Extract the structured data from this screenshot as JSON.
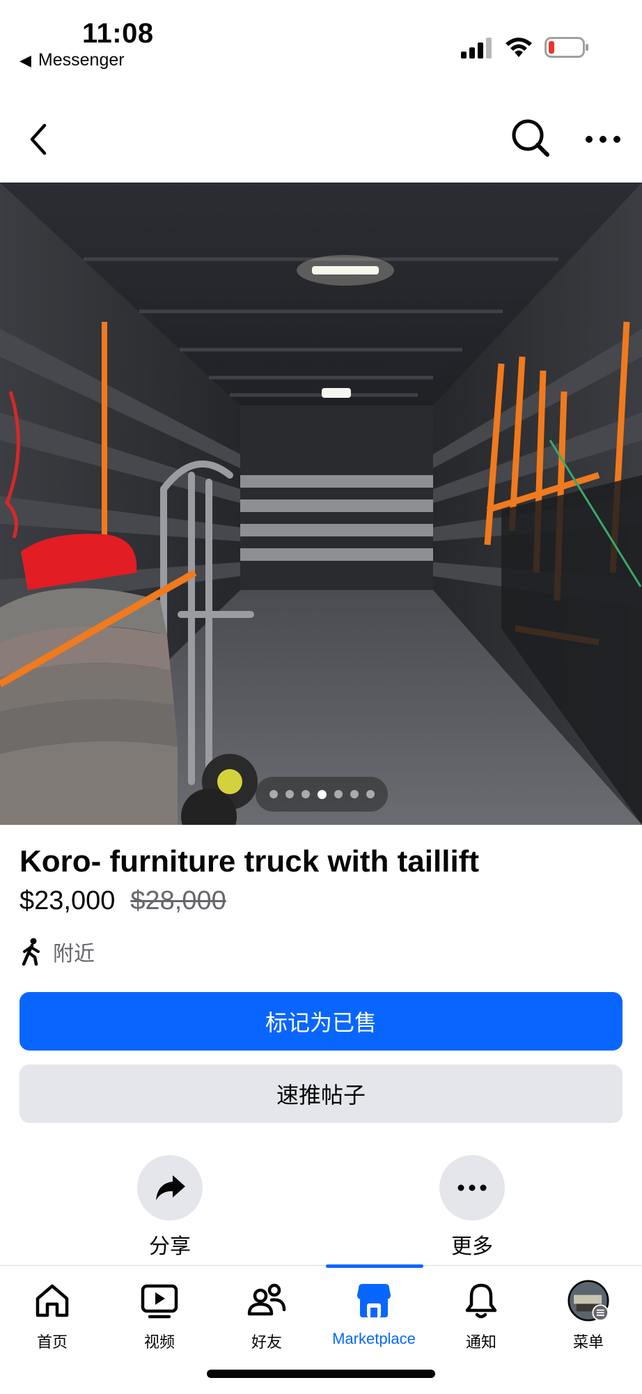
{
  "status_bar": {
    "time": "11:08",
    "back_app": "Messenger"
  },
  "nav": {
    "back_icon": "chevron-left-icon",
    "search_icon": "search-icon",
    "more_icon": "more-horizontal-icon"
  },
  "gallery": {
    "total_photos": 7,
    "current_index": 4
  },
  "listing": {
    "title": "Koro- furniture truck with taillift",
    "price": "$23,000",
    "original_price": "$28,000",
    "location": "附近"
  },
  "buttons": {
    "mark_sold": "标记为已售",
    "boost": "速推帖子"
  },
  "actions": {
    "share": "分享",
    "more": "更多"
  },
  "tabs": [
    {
      "label": "首页",
      "icon": "home-icon"
    },
    {
      "label": "视频",
      "icon": "video-icon"
    },
    {
      "label": "好友",
      "icon": "friends-icon"
    },
    {
      "label": "Marketplace",
      "icon": "marketplace-icon"
    },
    {
      "label": "通知",
      "icon": "bell-icon"
    },
    {
      "label": "菜单",
      "icon": "avatar-menu-icon"
    }
  ],
  "colors": {
    "accent": "#0866ff",
    "secondary_button": "#e4e6eb",
    "muted_text": "#65676b",
    "battery_low": "#e8372c"
  }
}
